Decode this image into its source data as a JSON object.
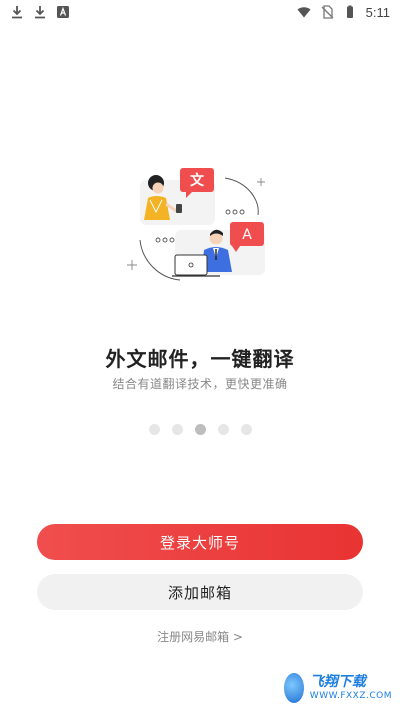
{
  "status_bar": {
    "time": "5:11",
    "left_icons": [
      "download-icon",
      "download-icon",
      "translate-app-icon"
    ],
    "right_icons": [
      "wifi-icon",
      "no-sim-icon",
      "battery-icon"
    ]
  },
  "illustration": {
    "bubble_1": "文",
    "bubble_2": "A",
    "accent": "#f04e4e"
  },
  "onboarding": {
    "title": "外文邮件，一键翻译",
    "subtitle": "结合有道翻译技术，更快更准确",
    "page_count": 5,
    "active_page": 3
  },
  "actions": {
    "login_label": "登录大师号",
    "add_mailbox_label": "添加邮箱",
    "register_label": "注册网易邮箱 >"
  },
  "watermark": {
    "title": "飞翔下载",
    "url": "WWW.FXXZ.COM"
  }
}
